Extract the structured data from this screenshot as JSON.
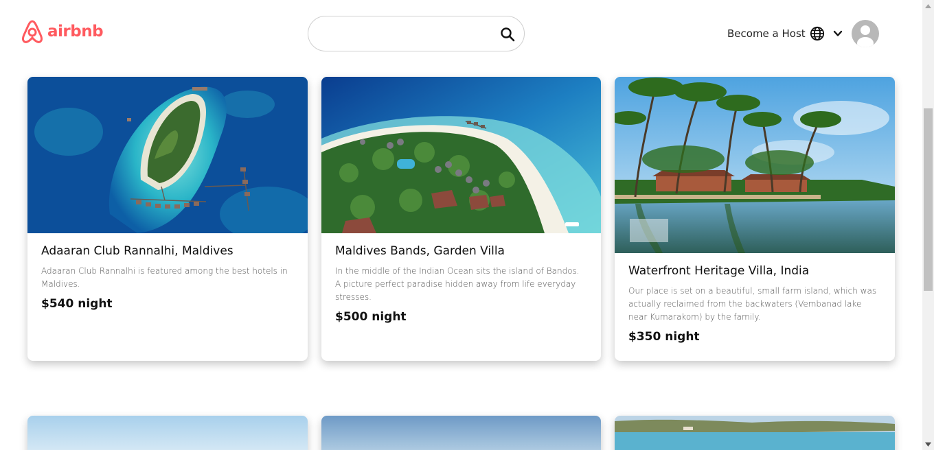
{
  "brand": {
    "name": "airbnb",
    "color": "#FF5A5F"
  },
  "search": {
    "value": "",
    "placeholder": ""
  },
  "header": {
    "host_label": "Become a Host"
  },
  "listings": [
    {
      "title": "Adaaran Club Rannalhi, Maldives",
      "description": "Adaaran Club Rannalhi is featured among the best hotels in Maldives.",
      "price": "$540 night"
    },
    {
      "title": "Maldives Bands, Garden Villa",
      "description": "In the middle of the Indian Ocean sits the island of Bandos. A picture perfect paradise hidden away from life everyday stresses.",
      "price": "$500 night"
    },
    {
      "title": "Waterfront Heritage Villa, India",
      "description": "Our place is set on a beautiful, small farm island, which was actually reclaimed from the backwaters (Vembanad lake near Kumarakom) by the family.",
      "price": "$350 night"
    }
  ],
  "icons": {
    "logo": "airbnb-logo-icon",
    "search": "search-icon",
    "globe": "globe-icon",
    "chevron": "chevron-down-icon",
    "avatar": "user-avatar-icon"
  }
}
